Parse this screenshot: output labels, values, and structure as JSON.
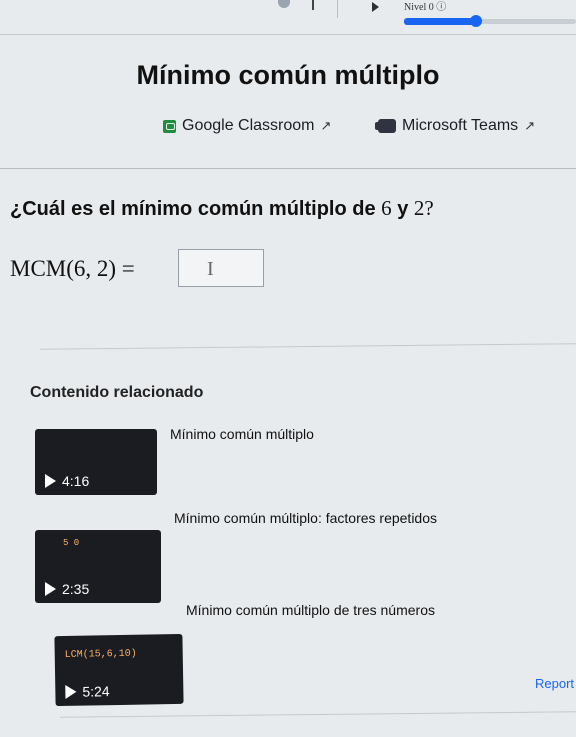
{
  "top": {
    "level_label": "Nivel 0 ⓘ",
    "progress": 0.4
  },
  "header": {
    "title": "Mínimo común múltiplo",
    "share_google": "Google Classroom",
    "share_teams": "Microsoft Teams"
  },
  "exercise": {
    "question_text": "¿Cuál es el mínimo común múltiplo de ",
    "question_a": "6",
    "question_and": " y ",
    "question_b": "2",
    "question_end": "?",
    "expression": "MCM(6, 2) =",
    "answer_value": ""
  },
  "related": {
    "heading": "Contenido relacionado",
    "videos": [
      {
        "title": "Mínimo común múltiplo",
        "duration": "4:16",
        "thumb_text": ""
      },
      {
        "title": "Mínimo común múltiplo: factores repetidos",
        "duration": "2:35",
        "thumb_text": "5 0"
      },
      {
        "title": "Mínimo común múltiplo de tres números",
        "duration": "5:24",
        "thumb_text": "LCM(15,6,10)"
      }
    ]
  },
  "footer": {
    "report_label": "Report"
  },
  "colors": {
    "accent": "#1865f2",
    "classroom_green": "#1e8e3e"
  }
}
